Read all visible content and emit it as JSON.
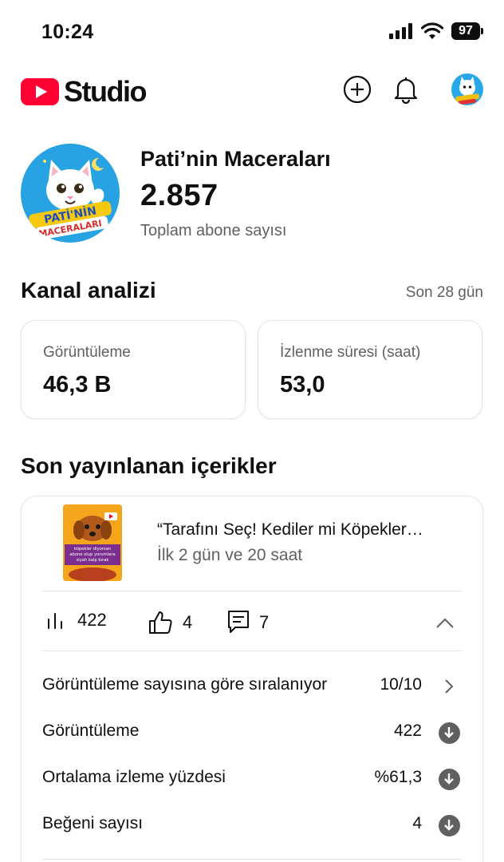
{
  "status_bar": {
    "time": "10:24",
    "battery": "97"
  },
  "app": {
    "logo_text": "Studio"
  },
  "channel": {
    "name": "Pati’nin Maceraları",
    "subscribers": "2.857",
    "subscribers_label": "Toplam abone sayısı",
    "logo_lettering": "PATİ'NİN MACERALARI"
  },
  "analytics": {
    "title": "Kanal analizi",
    "period": "Son 28 gün",
    "metrics": [
      {
        "label": "Görüntüleme",
        "value": "46,3 B"
      },
      {
        "label": "İzlenme süresi (saat)",
        "value": "53,0"
      }
    ]
  },
  "recent": {
    "title": "Son yayınlanan içerikler",
    "video": {
      "title": "“Tarafını Seç! Kediler mi Köpekler…",
      "subtitle": "İlk 2 gün ve 20 saat",
      "thumbnail_text": "köpekler diyorsan abone olup yorumlara siyah kalp bırak"
    },
    "stats": {
      "views": "422",
      "likes": "4",
      "comments": "7"
    },
    "rows": [
      {
        "label": "Görüntüleme sayısına göre sıralanıyor",
        "value": "10/10",
        "icon": "chevron-right-icon"
      },
      {
        "label": "Görüntüleme",
        "value": "422",
        "icon": "down-arrow-circle-icon"
      },
      {
        "label": "Ortalama izleme yüzdesi",
        "value": "%61,3",
        "icon": "down-arrow-circle-icon"
      },
      {
        "label": "Beğeni sayısı",
        "value": "4",
        "icon": "down-arrow-circle-icon"
      }
    ]
  },
  "colors": {
    "brand_red": "#ff0033",
    "text": "#0f0f0f",
    "secondary_text": "#606060",
    "divider": "#e5e5e5"
  }
}
